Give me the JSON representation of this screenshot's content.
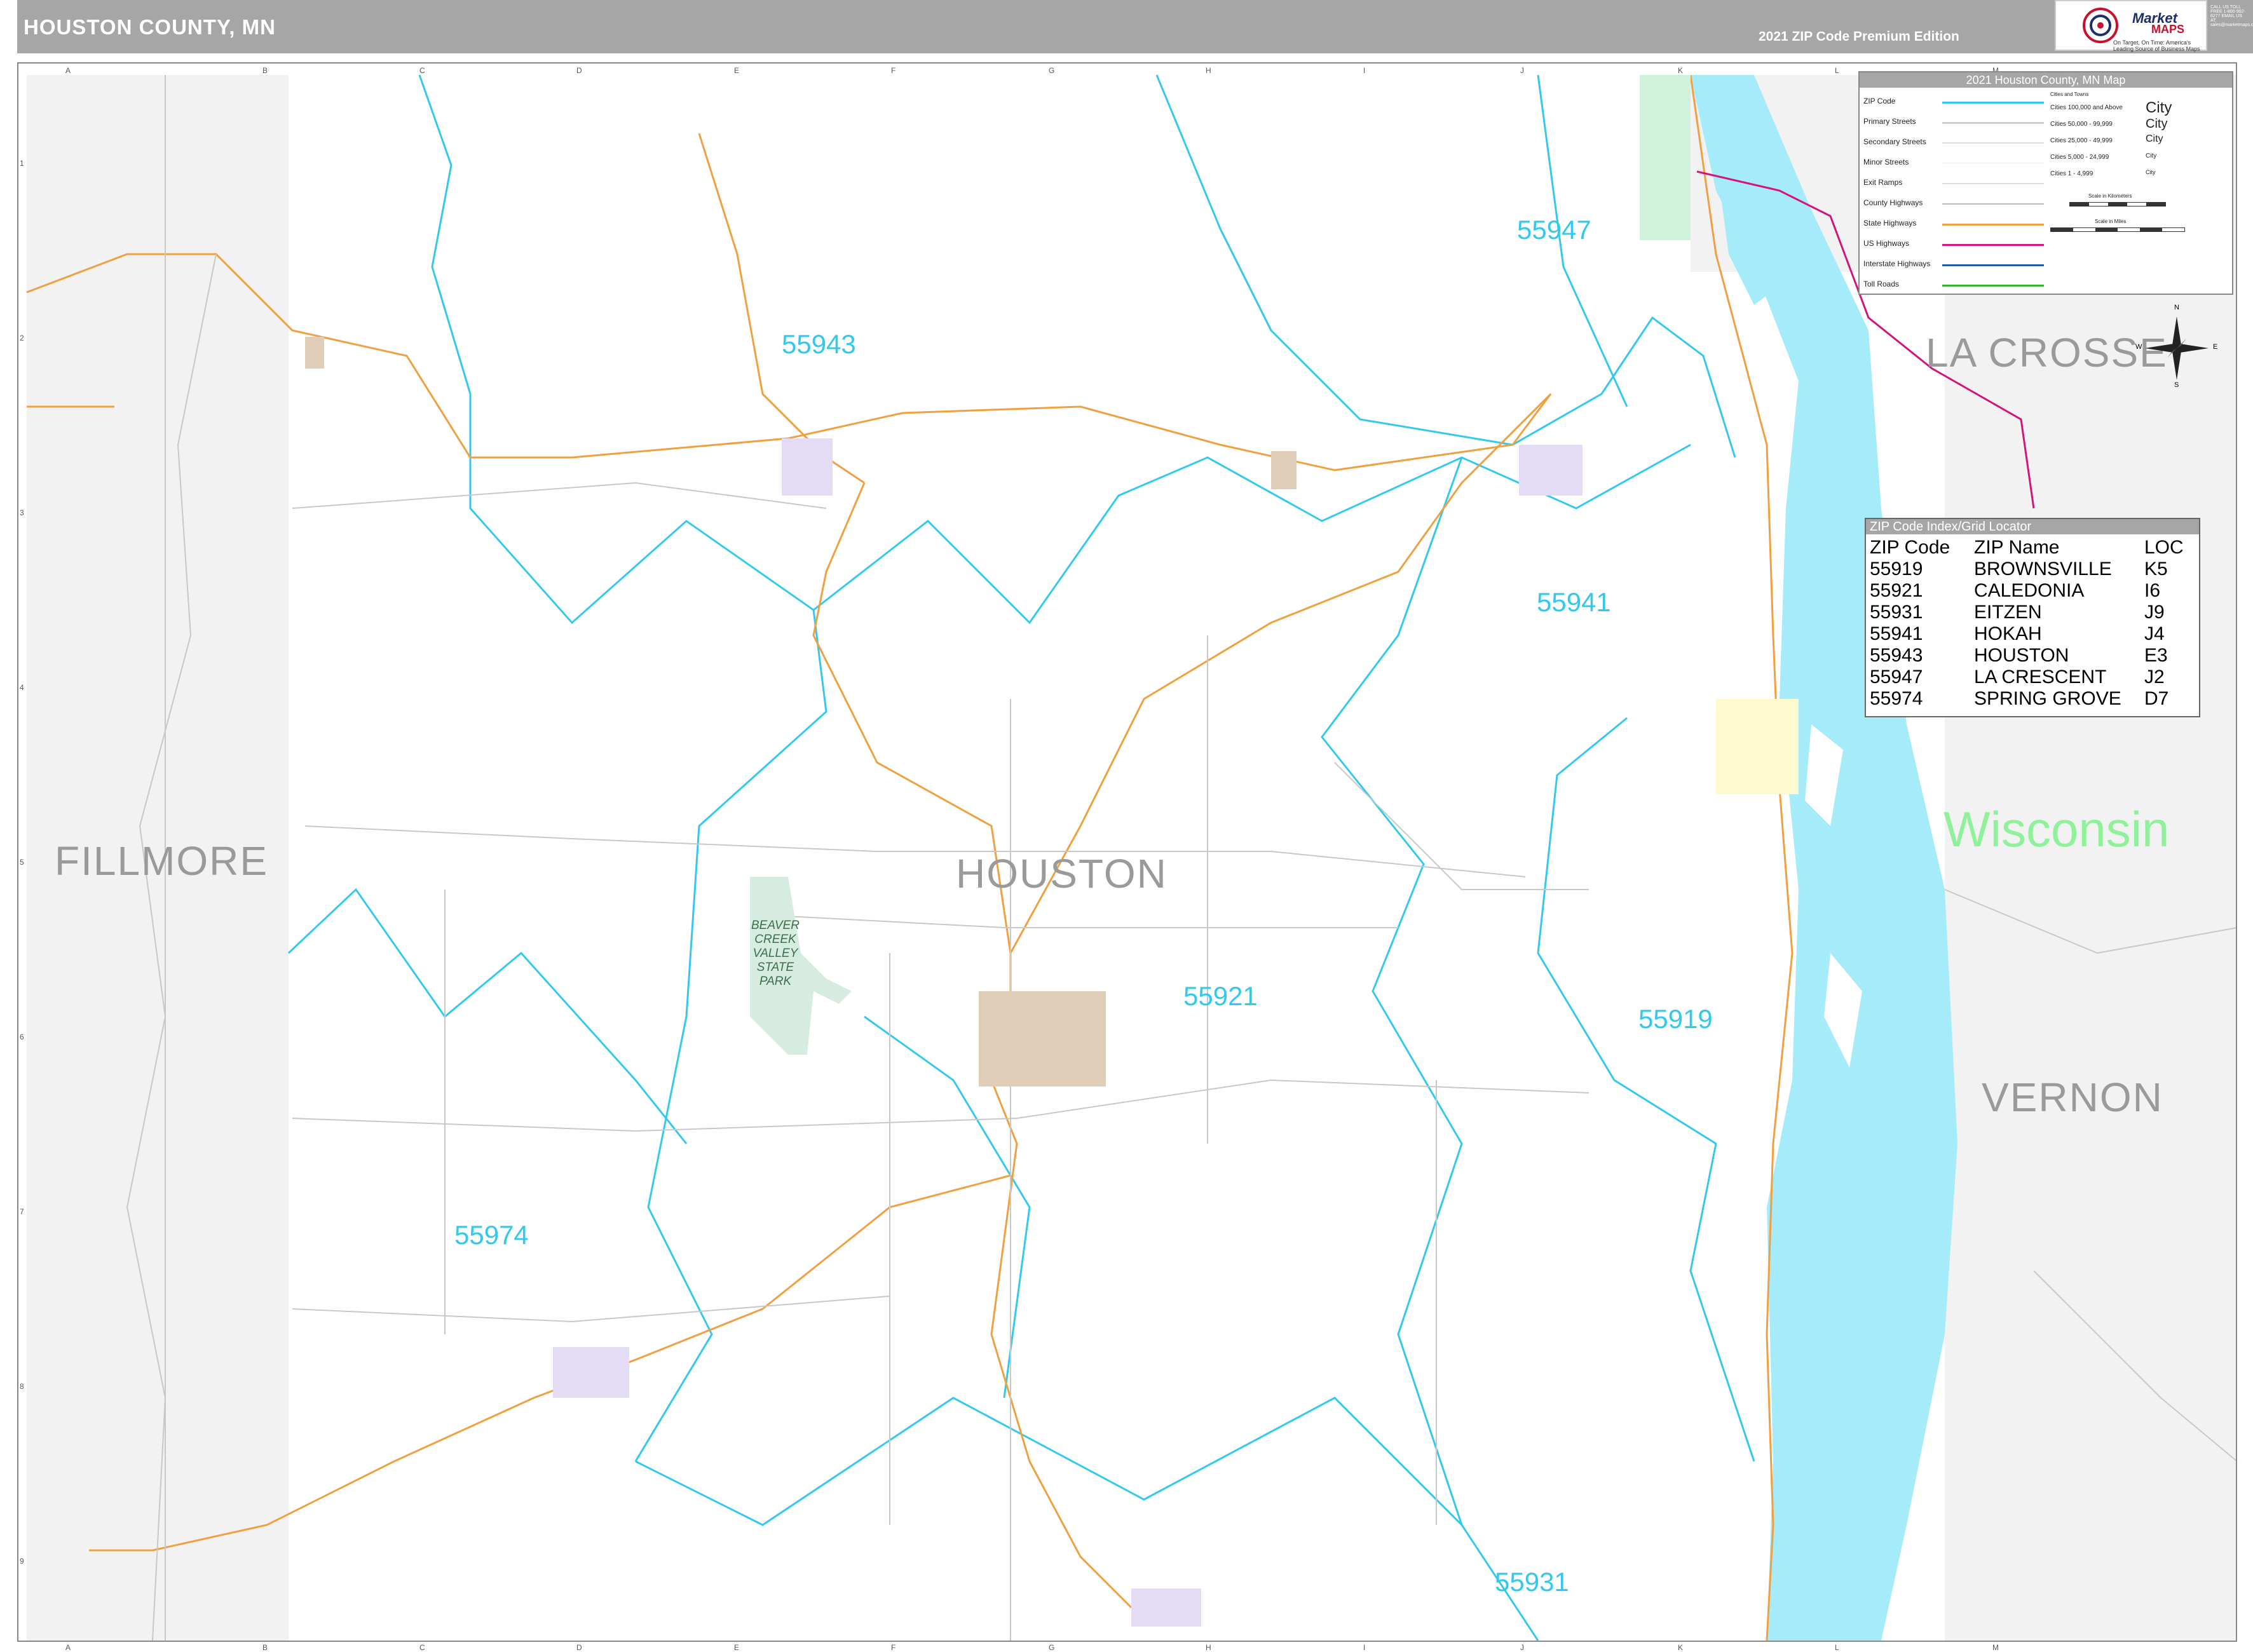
{
  "header": {
    "title": "HOUSTON COUNTY, MN",
    "edition": "2021 ZIP Code Premium Edition",
    "logo_text": "Market",
    "logo_sub": "MAPS",
    "logo_tagline": "On Target, On Time: America's Leading Source of Business Maps",
    "contact": "CALL US TOLL FREE 1-800-992-6277 EMAIL US AT: sales@marketmaps.com"
  },
  "grid": {
    "columns": [
      "A",
      "B",
      "C",
      "D",
      "E",
      "F",
      "G",
      "H",
      "I",
      "J",
      "K",
      "L",
      "M"
    ],
    "rows": [
      "1",
      "2",
      "3",
      "4",
      "5",
      "6",
      "7",
      "8",
      "9"
    ]
  },
  "legend": {
    "title": "2021 Houston County, MN Map",
    "items": [
      {
        "label": "ZIP Code",
        "color": "#33c9ef"
      },
      {
        "label": "Primary Streets",
        "color": "#cfcfcf"
      },
      {
        "label": "Secondary Streets",
        "color": "#dddddd"
      },
      {
        "label": "Minor Streets",
        "color": "#eeeeee"
      },
      {
        "label": "Exit Ramps",
        "color": "#dddddd"
      },
      {
        "label": "County Highways",
        "color": "#bbbbbb"
      },
      {
        "label": "State Highways",
        "color": "#f0a040"
      },
      {
        "label": "US Highways",
        "color": "#d4147a"
      },
      {
        "label": "Interstate Highways",
        "color": "#1a5cb0"
      },
      {
        "label": "Toll Roads",
        "color": "#2db32d"
      }
    ],
    "cities_heading": "Cities and Towns",
    "cities": [
      {
        "label": "Cities 100,000 and Above",
        "sample": "City"
      },
      {
        "label": "Cities 50,000 - 99,999",
        "sample": "City"
      },
      {
        "label": "Cities 25,000 - 49,999",
        "sample": "City"
      },
      {
        "label": "Cities 5,000 - 24,999",
        "sample": "City"
      },
      {
        "label": "Cities 1 - 4,999",
        "sample": "City"
      }
    ],
    "scale_km": "Scale in Kilometers",
    "scale_mi": "Scale in Miles"
  },
  "zip_index": {
    "title": "ZIP Code Index/Grid Locator",
    "headers": [
      "ZIP Code",
      "ZIP Name",
      "LOC"
    ],
    "rows": [
      [
        "55919",
        "BROWNSVILLE",
        "K5"
      ],
      [
        "55921",
        "CALEDONIA",
        "I6"
      ],
      [
        "55931",
        "EITZEN",
        "J9"
      ],
      [
        "55941",
        "HOKAH",
        "J4"
      ],
      [
        "55943",
        "HOUSTON",
        "E3"
      ],
      [
        "55947",
        "LA CRESCENT",
        "J2"
      ],
      [
        "55974",
        "SPRING GROVE",
        "D7"
      ]
    ]
  },
  "zip_labels": [
    "55947",
    "55943",
    "55941",
    "55921",
    "55919",
    "55974",
    "55931"
  ],
  "county_labels": [
    "FILLMORE",
    "HOUSTON",
    "LA CROSSE",
    "VERNON"
  ],
  "state_label": "Wisconsin",
  "park_label": "BEAVER CREEK VALLEY STATE PARK",
  "compass": {
    "n": "N",
    "s": "S",
    "e": "E",
    "w": "W"
  },
  "colors": {
    "zip_boundary": "#33c9ef",
    "water": "#a6ebf9",
    "state_highway": "#f0a040",
    "us_highway": "#d4147a",
    "outside_county": "#f2f2f2",
    "park": "#d6ece0"
  }
}
